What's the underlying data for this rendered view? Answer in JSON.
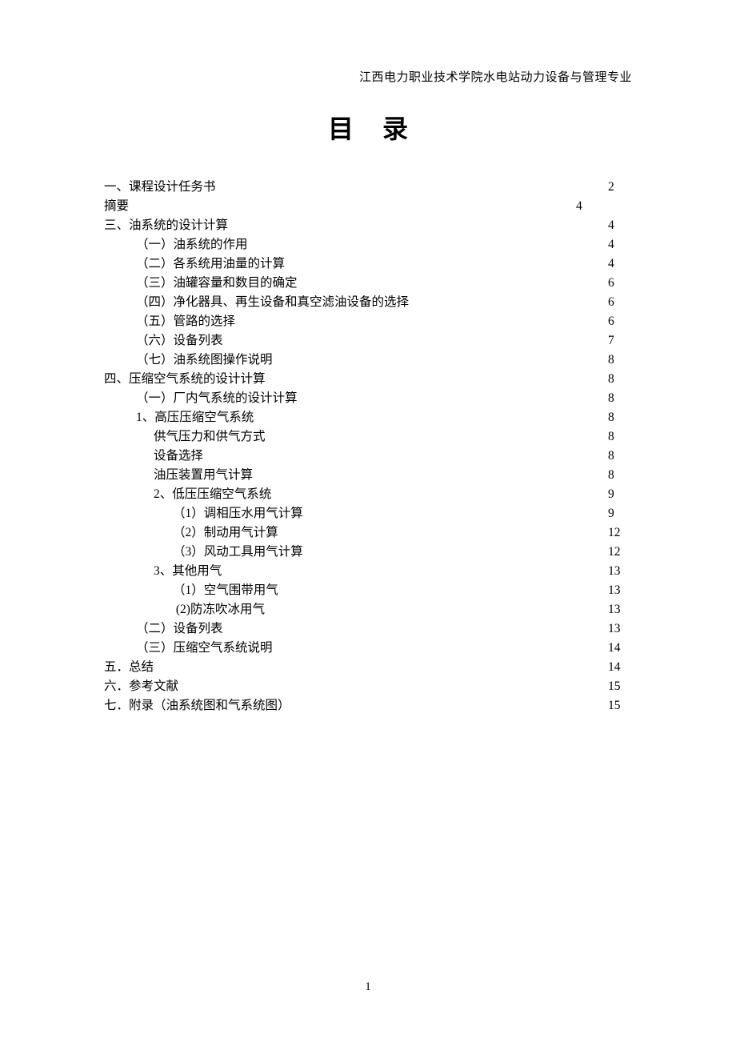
{
  "header": "江西电力职业技术学院水电站动力设备与管理专业",
  "title_char1": "目",
  "title_char2": "录",
  "page_number": "1",
  "toc": [
    {
      "label": "一、课程设计任务书",
      "page": "2",
      "indent": 0,
      "shortLine": false
    },
    {
      "label": "摘要",
      "page": "4",
      "indent": 0,
      "shortLine": true
    },
    {
      "label": "三、油系统的设计计算",
      "page": "4",
      "indent": 0,
      "shortLine": false
    },
    {
      "label": "（一）油系统的作用",
      "page": "4",
      "indent": 1,
      "shortLine": false
    },
    {
      "label": "（二）各系统用油量的计算",
      "page": "4",
      "indent": 1,
      "shortLine": false
    },
    {
      "label": "（三）油罐容量和数目的确定",
      "page": "6",
      "indent": 1,
      "shortLine": false
    },
    {
      "label": "（四）净化器具、再生设备和真空滤油设备的选择",
      "page": "6",
      "indent": 1,
      "shortLine": false
    },
    {
      "label": "（五）管路的选择",
      "page": "6",
      "indent": 1,
      "shortLine": false
    },
    {
      "label": "（六）设备列表",
      "page": "7",
      "indent": 1,
      "shortLine": false
    },
    {
      "label": "（七）油系统图操作说明",
      "page": "8",
      "indent": 1,
      "shortLine": false
    },
    {
      "label": "四、压缩空气系统的设计计算",
      "page": "8",
      "indent": 0,
      "shortLine": false
    },
    {
      "label": "（一）厂内气系统的设计计算",
      "page": "8",
      "indent": 1,
      "shortLine": false
    },
    {
      "label": "1、高压压缩空气系统",
      "page": "8",
      "indent": 1,
      "shortLine": false
    },
    {
      "label": "供气压力和供气方式",
      "page": "8",
      "indent": 2,
      "shortLine": false
    },
    {
      "label": "设备选择",
      "page": "8",
      "indent": 2,
      "shortLine": false
    },
    {
      "label": "油压装置用气计算",
      "page": "8",
      "indent": 2,
      "shortLine": false
    },
    {
      "label": "2、低压压缩空气系统",
      "page": "9",
      "indent": 2,
      "shortLine": false
    },
    {
      "label": "（1）调相压水用气计算",
      "page": "9",
      "indent": 3,
      "shortLine": false
    },
    {
      "label": "（2）制动用气计算",
      "page": "12",
      "indent": 3,
      "shortLine": false
    },
    {
      "label": "（3）风动工具用气计算",
      "page": "12",
      "indent": 3,
      "shortLine": false
    },
    {
      "label": "3、其他用气",
      "page": "13",
      "indent": 2,
      "shortLine": false
    },
    {
      "label": "（1）空气围带用气",
      "page": "13",
      "indent": 3,
      "shortLine": false
    },
    {
      "label": " (2)防冻吹冰用气",
      "page": "13",
      "indent": 3,
      "shortLine": false
    },
    {
      "label": "（二）设备列表",
      "page": "13",
      "indent": 1,
      "shortLine": false
    },
    {
      "label": "（三）压缩空气系统说明",
      "page": "14",
      "indent": 1,
      "shortLine": false
    },
    {
      "label": "五．总结",
      "page": "14",
      "indent": 0,
      "shortLine": false
    },
    {
      "label": "六．参考文献",
      "page": "15",
      "indent": 0,
      "shortLine": false
    },
    {
      "label": "七．附录（油系统图和气系统图）",
      "page": "15",
      "indent": 0,
      "shortLine": false
    }
  ]
}
